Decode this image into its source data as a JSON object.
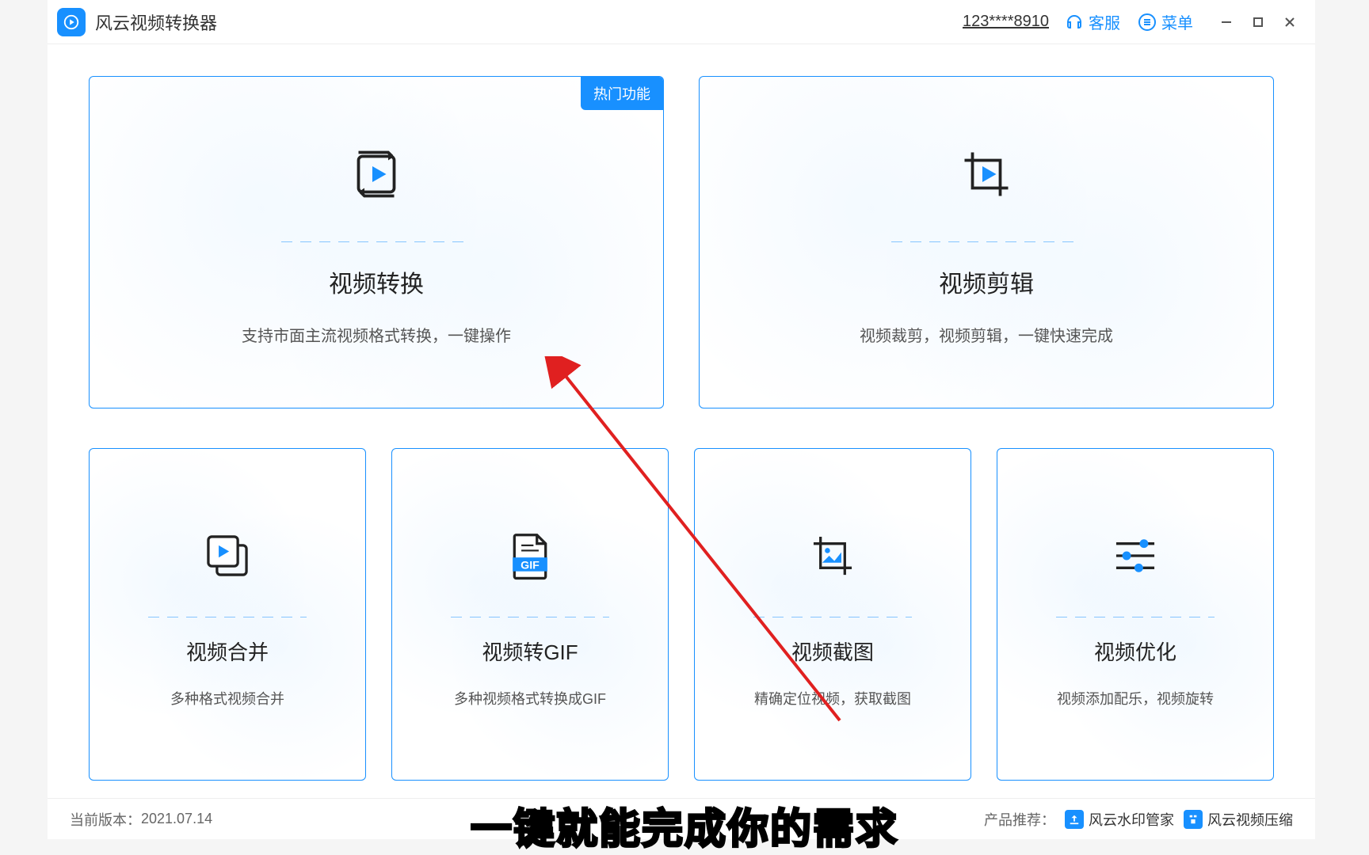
{
  "app": {
    "title": "风云视频转换器"
  },
  "header": {
    "user_id": "123****8910",
    "service_label": "客服",
    "menu_label": "菜单"
  },
  "cards": {
    "convert": {
      "badge": "热门功能",
      "title": "视频转换",
      "sub": "支持市面主流视频格式转换，一键操作"
    },
    "edit": {
      "title": "视频剪辑",
      "sub": "视频裁剪，视频剪辑，一键快速完成"
    },
    "merge": {
      "title": "视频合并",
      "sub": "多种格式视频合并"
    },
    "gif": {
      "title": "视频转GIF",
      "gif_word": "GIF",
      "sub": "多种视频格式转换成GIF"
    },
    "screenshot": {
      "title": "视频截图",
      "sub": "精确定位视频，获取截图"
    },
    "optimize": {
      "title": "视频优化",
      "sub": "视频添加配乐，视频旋转"
    }
  },
  "footer": {
    "version_label": "当前版本：",
    "version_value": "2021.07.14",
    "recommend_label": "产品推荐：",
    "rec1": "风云水印管家",
    "rec2": "风云视频压缩"
  },
  "overlay": {
    "caption": "一键就能完成你的需求"
  }
}
